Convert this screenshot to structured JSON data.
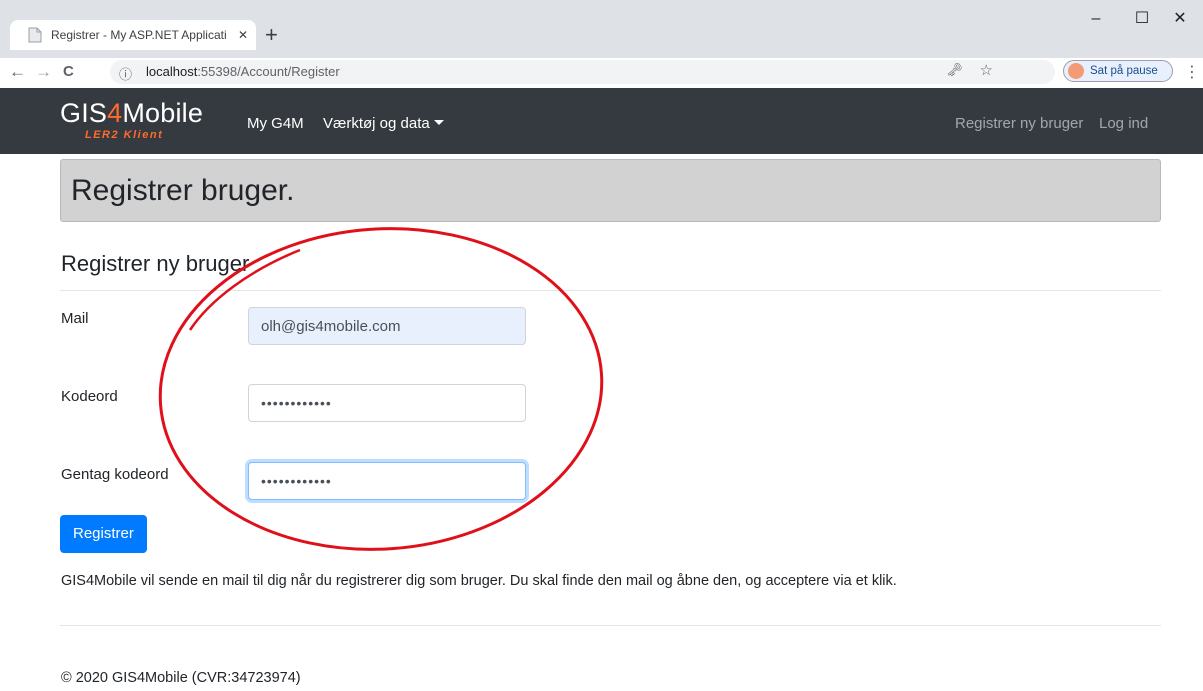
{
  "browser": {
    "tab_title": "Registrer - My ASP.NET Applicati",
    "tab_close": "✕",
    "new_tab": "+",
    "url_host": "localhost",
    "url_path": ":55398/Account/Register",
    "profile_status": "Sat på pause",
    "window_controls": {
      "minimize": "–",
      "maximize": "☐",
      "close": "✕"
    },
    "nav_icons": {
      "back": "←",
      "forward": "→",
      "reload": "C",
      "info": "ⓘ",
      "key": "🗝",
      "star": "☆",
      "menu": "⋮"
    }
  },
  "navbar": {
    "brand_prefix": "GIS",
    "brand_accent": "4",
    "brand_suffix": "Mobile",
    "brand_sub": "LER2 Klient",
    "links": {
      "my": "My G4M",
      "tools": "Værktøj og data",
      "register": "Registrer ny bruger",
      "login": "Log ind"
    }
  },
  "page": {
    "title": "Registrer bruger.",
    "subheading": "Registrer ny bruger",
    "form": {
      "email_label": "Mail",
      "email_value": "olh@gis4mobile.com",
      "password_label": "Kodeord",
      "password_value": "••••••••••••",
      "confirm_label": "Gentag kodeord",
      "confirm_value": "••••••••••••",
      "submit_label": "Registrer"
    },
    "info_note": "GIS4Mobile vil sende en mail til dig når du registrerer dig som bruger. Du skal finde den mail og åbne den, og acceptere via et klik.",
    "footer": "© 2020 GIS4Mobile (CVR:34723974)"
  },
  "colors": {
    "navbar_bg": "#343a40",
    "brand_accent": "#ff6b2c",
    "primary": "#007bff",
    "jumbotron_bg": "#d2d2d2",
    "annotation": "#e0101b"
  }
}
